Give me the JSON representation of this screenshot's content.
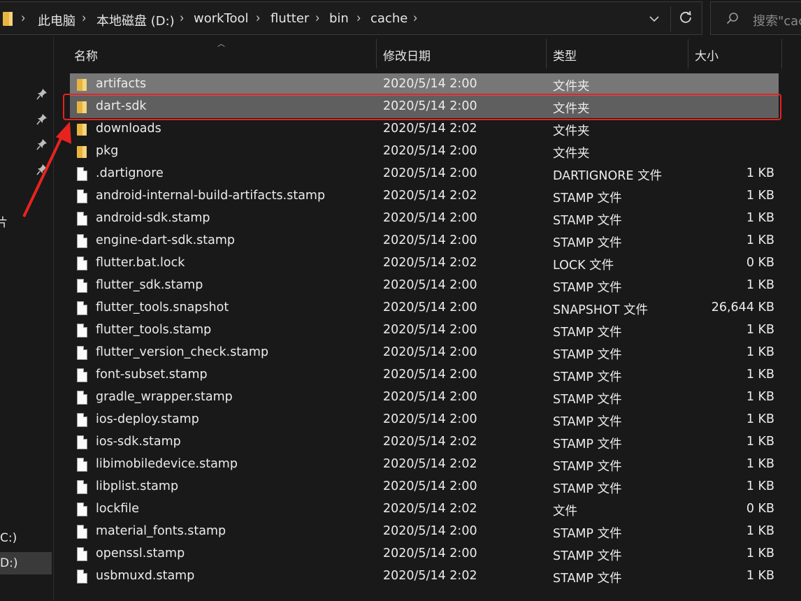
{
  "address_bar": {
    "breadcrumbs": [
      "此电脑",
      "本地磁盘 (D:)",
      "workTool",
      "flutter",
      "bin",
      "cache"
    ],
    "separator": "›",
    "dropdown_icon": "chevron-down",
    "refresh_icon": "refresh"
  },
  "search": {
    "placeholder": "搜索\"cache\"",
    "icon": "search"
  },
  "nav_pane": {
    "fragments": [
      {
        "text": "片"
      },
      {
        "text": "C:)"
      },
      {
        "text": "D:)"
      }
    ],
    "pin_icons": 4
  },
  "columns": {
    "name": "名称",
    "date": "修改日期",
    "type": "类型",
    "size": "大小"
  },
  "files": [
    {
      "name": "artifacts",
      "date": "2020/5/14 2:00",
      "type": "文件夹",
      "size": "",
      "kind": "folder",
      "state": "selected"
    },
    {
      "name": "dart-sdk",
      "date": "2020/5/14 2:00",
      "type": "文件夹",
      "size": "",
      "kind": "folder",
      "state": "selected-highlighted"
    },
    {
      "name": "downloads",
      "date": "2020/5/14 2:02",
      "type": "文件夹",
      "size": "",
      "kind": "folder",
      "state": ""
    },
    {
      "name": "pkg",
      "date": "2020/5/14 2:00",
      "type": "文件夹",
      "size": "",
      "kind": "folder",
      "state": ""
    },
    {
      "name": ".dartignore",
      "date": "2020/5/14 2:00",
      "type": "DARTIGNORE 文件",
      "size": "1 KB",
      "kind": "file",
      "state": ""
    },
    {
      "name": "android-internal-build-artifacts.stamp",
      "date": "2020/5/14 2:02",
      "type": "STAMP 文件",
      "size": "1 KB",
      "kind": "file",
      "state": ""
    },
    {
      "name": "android-sdk.stamp",
      "date": "2020/5/14 2:00",
      "type": "STAMP 文件",
      "size": "1 KB",
      "kind": "file",
      "state": ""
    },
    {
      "name": "engine-dart-sdk.stamp",
      "date": "2020/5/14 2:00",
      "type": "STAMP 文件",
      "size": "1 KB",
      "kind": "file",
      "state": ""
    },
    {
      "name": "flutter.bat.lock",
      "date": "2020/5/14 2:02",
      "type": "LOCK 文件",
      "size": "0 KB",
      "kind": "file",
      "state": ""
    },
    {
      "name": "flutter_sdk.stamp",
      "date": "2020/5/14 2:00",
      "type": "STAMP 文件",
      "size": "1 KB",
      "kind": "file",
      "state": ""
    },
    {
      "name": "flutter_tools.snapshot",
      "date": "2020/5/14 2:00",
      "type": "SNAPSHOT 文件",
      "size": "26,644 KB",
      "kind": "file",
      "state": ""
    },
    {
      "name": "flutter_tools.stamp",
      "date": "2020/5/14 2:00",
      "type": "STAMP 文件",
      "size": "1 KB",
      "kind": "file",
      "state": ""
    },
    {
      "name": "flutter_version_check.stamp",
      "date": "2020/5/14 2:00",
      "type": "STAMP 文件",
      "size": "1 KB",
      "kind": "file",
      "state": ""
    },
    {
      "name": "font-subset.stamp",
      "date": "2020/5/14 2:00",
      "type": "STAMP 文件",
      "size": "1 KB",
      "kind": "file",
      "state": ""
    },
    {
      "name": "gradle_wrapper.stamp",
      "date": "2020/5/14 2:00",
      "type": "STAMP 文件",
      "size": "1 KB",
      "kind": "file",
      "state": ""
    },
    {
      "name": "ios-deploy.stamp",
      "date": "2020/5/14 2:00",
      "type": "STAMP 文件",
      "size": "1 KB",
      "kind": "file",
      "state": ""
    },
    {
      "name": "ios-sdk.stamp",
      "date": "2020/5/14 2:02",
      "type": "STAMP 文件",
      "size": "1 KB",
      "kind": "file",
      "state": ""
    },
    {
      "name": "libimobiledevice.stamp",
      "date": "2020/5/14 2:02",
      "type": "STAMP 文件",
      "size": "1 KB",
      "kind": "file",
      "state": ""
    },
    {
      "name": "libplist.stamp",
      "date": "2020/5/14 2:00",
      "type": "STAMP 文件",
      "size": "1 KB",
      "kind": "file",
      "state": ""
    },
    {
      "name": "lockfile",
      "date": "2020/5/14 2:02",
      "type": "文件",
      "size": "0 KB",
      "kind": "file",
      "state": ""
    },
    {
      "name": "material_fonts.stamp",
      "date": "2020/5/14 2:00",
      "type": "STAMP 文件",
      "size": "1 KB",
      "kind": "file",
      "state": ""
    },
    {
      "name": "openssl.stamp",
      "date": "2020/5/14 2:00",
      "type": "STAMP 文件",
      "size": "1 KB",
      "kind": "file",
      "state": ""
    },
    {
      "name": "usbmuxd.stamp",
      "date": "2020/5/14 2:02",
      "type": "STAMP 文件",
      "size": "1 KB",
      "kind": "file",
      "state": ""
    }
  ],
  "annotation": {
    "highlight_color": "#e8231f",
    "arrow_color": "#e8231f"
  },
  "colors": {
    "background": "#191919",
    "selected_row": "#777777",
    "folder": "#e8b441"
  }
}
